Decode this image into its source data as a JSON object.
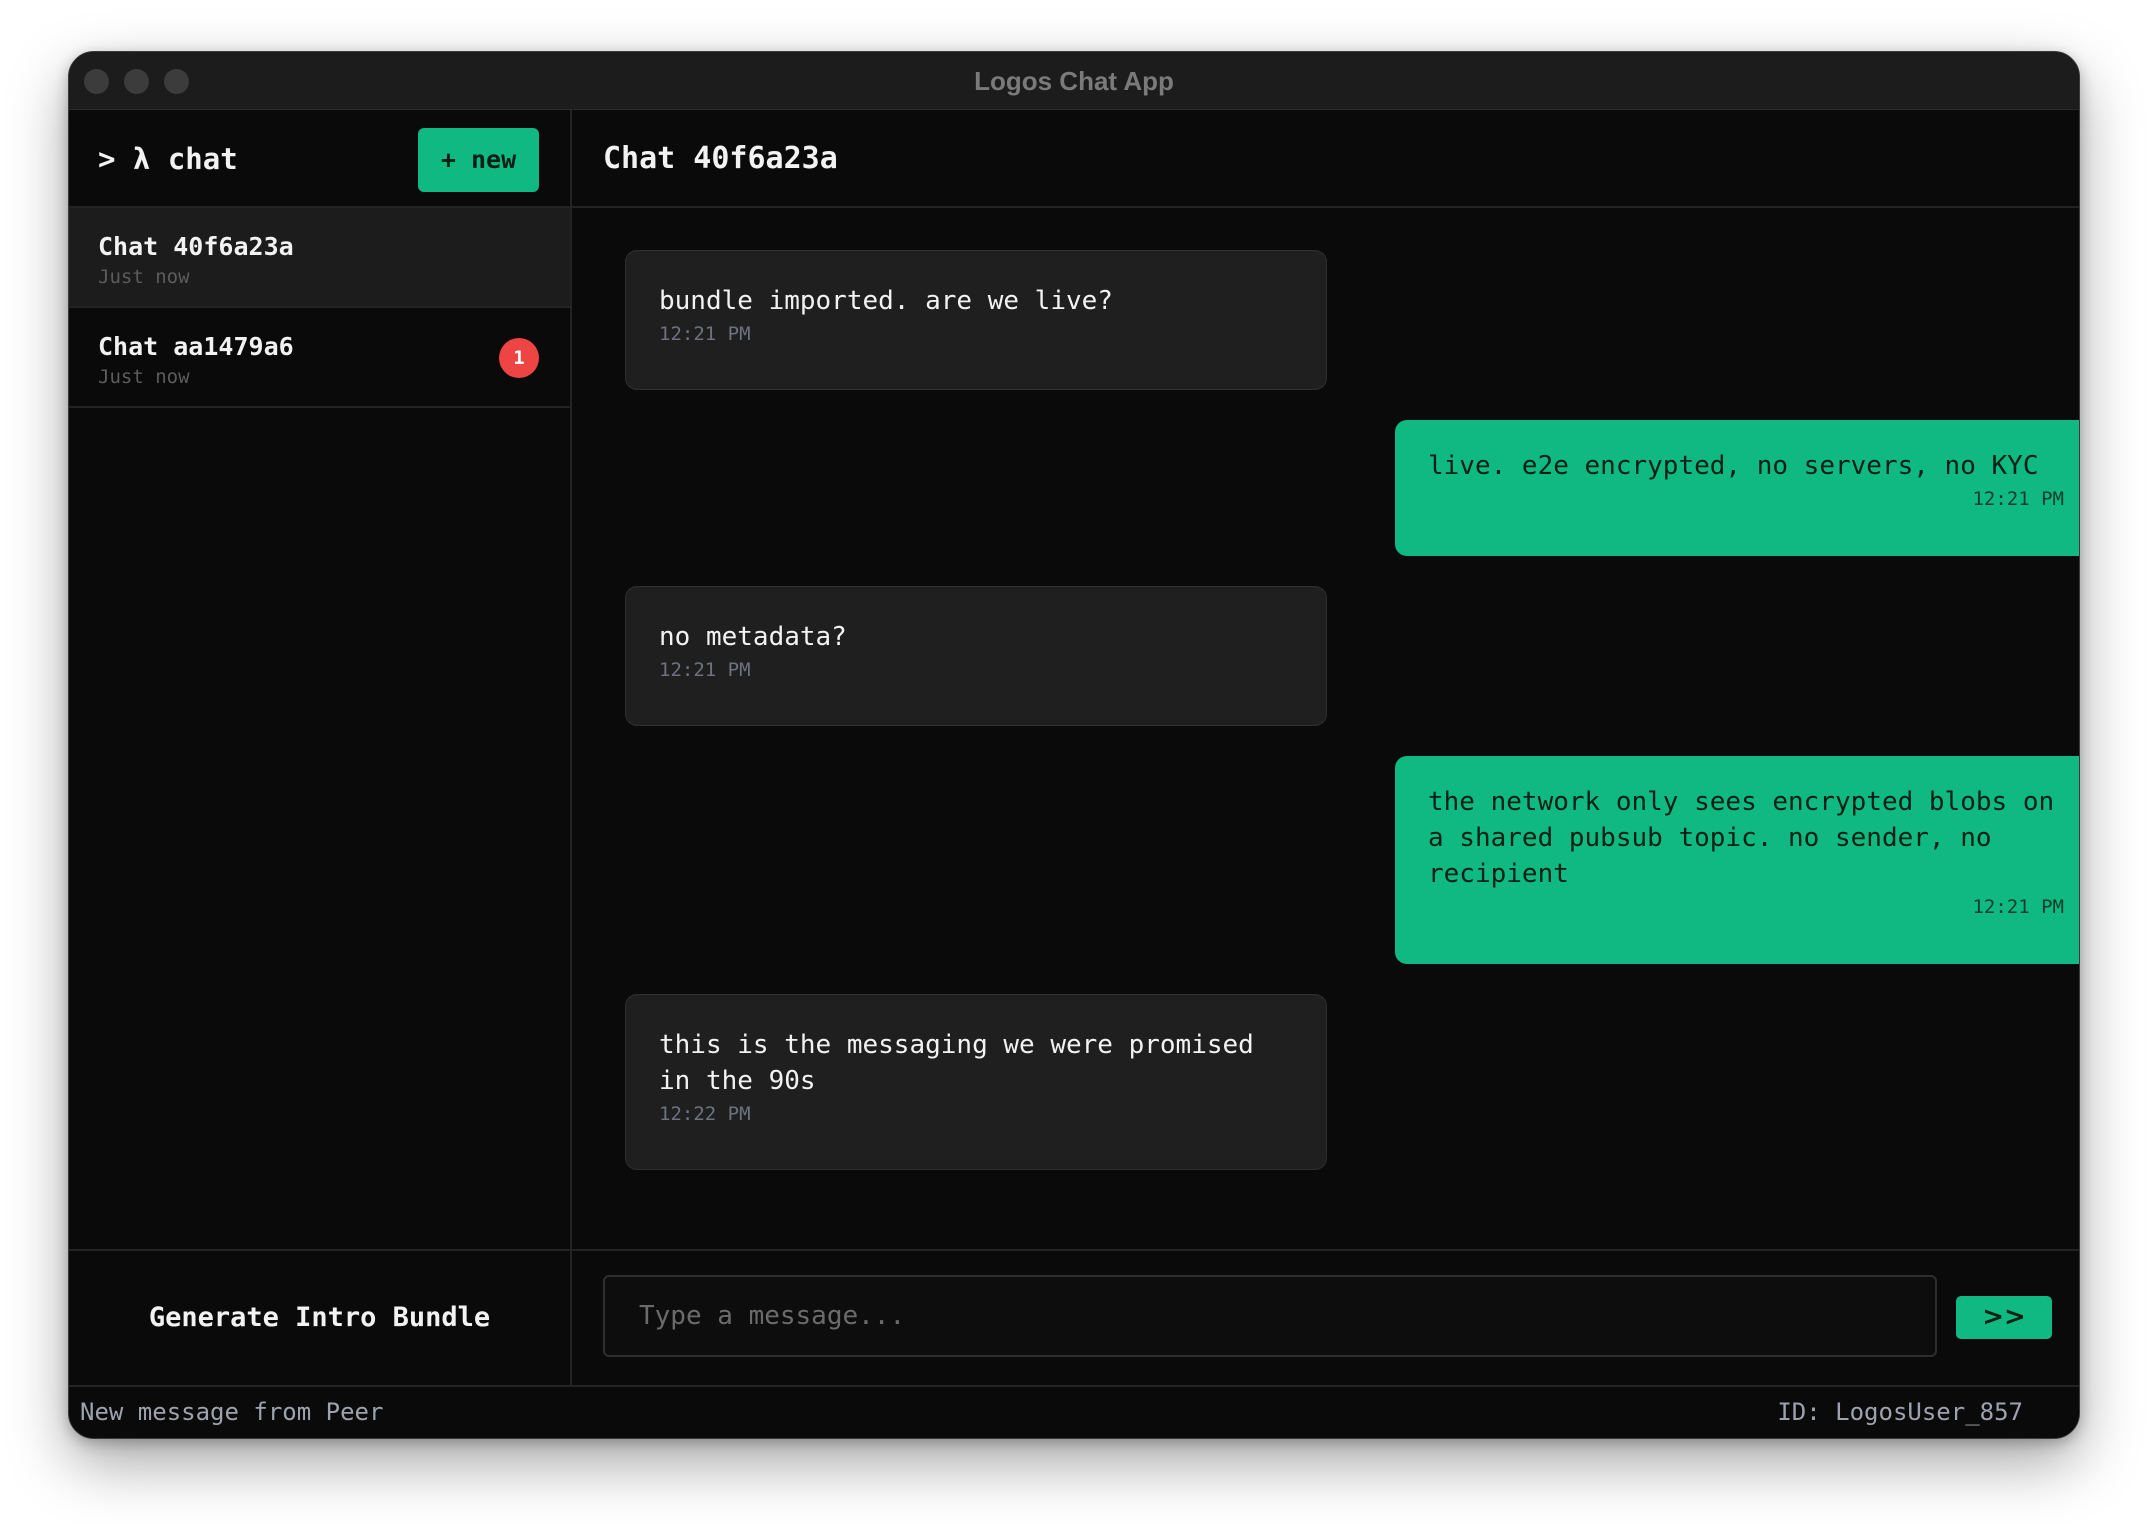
{
  "window": {
    "title": "Logos Chat App"
  },
  "sidebar": {
    "brand": "> λ chat",
    "new_button": "+ new",
    "chats": [
      {
        "title": "Chat 40f6a23a",
        "time": "Just now",
        "active": true
      },
      {
        "title": "Chat aa1479a6",
        "time": "Just now",
        "unread": "1"
      }
    ],
    "footer_button": "Generate Intro Bundle"
  },
  "main": {
    "title": "Chat 40f6a23a",
    "messages": [
      {
        "direction": "in",
        "text": "bundle imported. are we live?",
        "time": "12:21 PM"
      },
      {
        "direction": "out",
        "text": "live. e2e encrypted, no servers, no KYC",
        "time": "12:21 PM"
      },
      {
        "direction": "in",
        "text": "no metadata?",
        "time": "12:21 PM"
      },
      {
        "direction": "out",
        "text": "the network only sees encrypted blobs on a shared pubsub topic. no sender, no recipient",
        "time": "12:21 PM"
      },
      {
        "direction": "in",
        "text": "this is the messaging we were promised in the 90s",
        "time": "12:22 PM"
      }
    ],
    "composer": {
      "placeholder": "Type a message...",
      "value": "",
      "send_label": ">>"
    }
  },
  "status": {
    "left": "New message from Peer",
    "right": "ID: LogosUser_857"
  },
  "colors": {
    "accent": "#10b981",
    "badge": "#ef4444",
    "background": "#0a0a0a",
    "incoming_bubble": "#1f1f1f"
  }
}
